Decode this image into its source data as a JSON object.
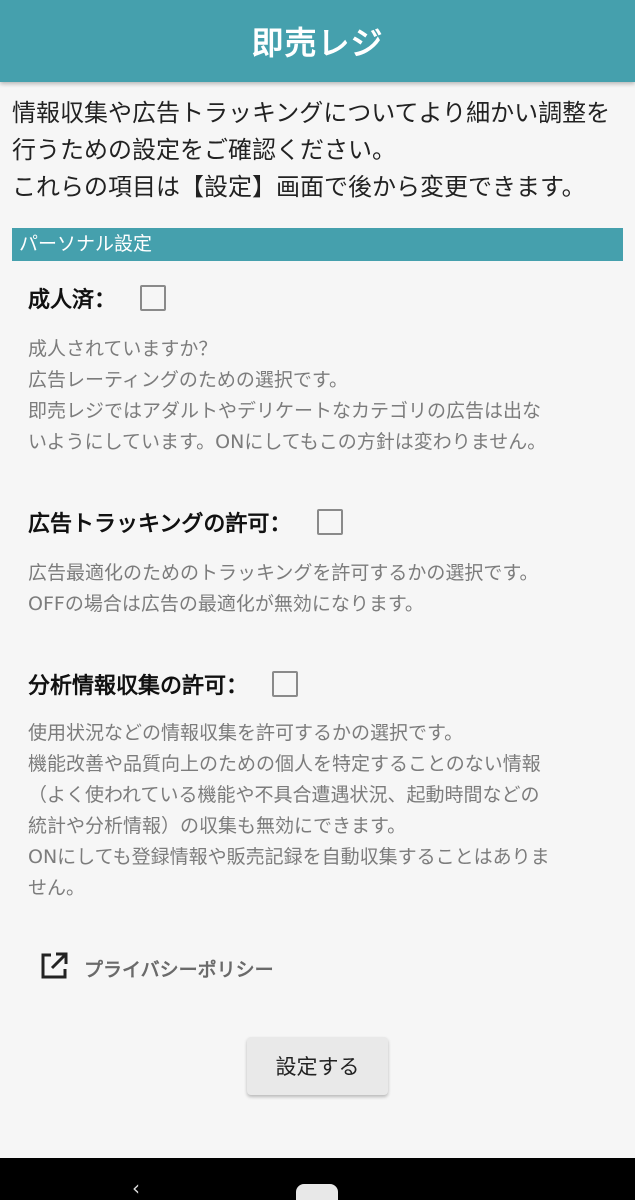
{
  "appbar": {
    "title": "即売レジ"
  },
  "intro": {
    "line1": "情報収集や広告トラッキングについてより細かい調整を",
    "line2": "行うための設定をご確認ください。",
    "line3": "これらの項目は【設定】画面で後から変更できます。"
  },
  "section": {
    "title": "パーソナル設定"
  },
  "settings": [
    {
      "label": "成人済：",
      "checked": false,
      "desc": [
        "成人されていますか？",
        "広告レーティングのための選択です。",
        "即売レジではアダルトやデリケートなカテゴリの広告は出な",
        "いようにしています。ONにしてもこの方針は変わりません。"
      ]
    },
    {
      "label": "広告トラッキングの許可：",
      "checked": false,
      "desc": [
        "広告最適化のためのトラッキングを許可するかの選択です。",
        "OFFの場合は広告の最適化が無効になります。"
      ]
    },
    {
      "label": "分析情報収集の許可：",
      "checked": false,
      "desc": [
        "使用状況などの情報収集を許可するかの選択です。",
        "機能改善や品質向上のための個人を特定することのない情報",
        "（よく使われている機能や不具合遭遇状況、起動時間などの",
        "統計や分析情報）の収集も無効にできます。",
        "ONにしても登録情報や販売記録を自動収集することはありま",
        "せん。"
      ]
    }
  ],
  "privacy_link": {
    "label": "プライバシーポリシー",
    "icon": "external-link-icon"
  },
  "submit": {
    "label": "設定する"
  },
  "navbar": {
    "back_icon": "‹",
    "home_icon": "home-pill-icon"
  },
  "colors": {
    "accent": "#45a0ad",
    "background": "#f6f6f6",
    "desc_text": "#7c7c7c"
  }
}
